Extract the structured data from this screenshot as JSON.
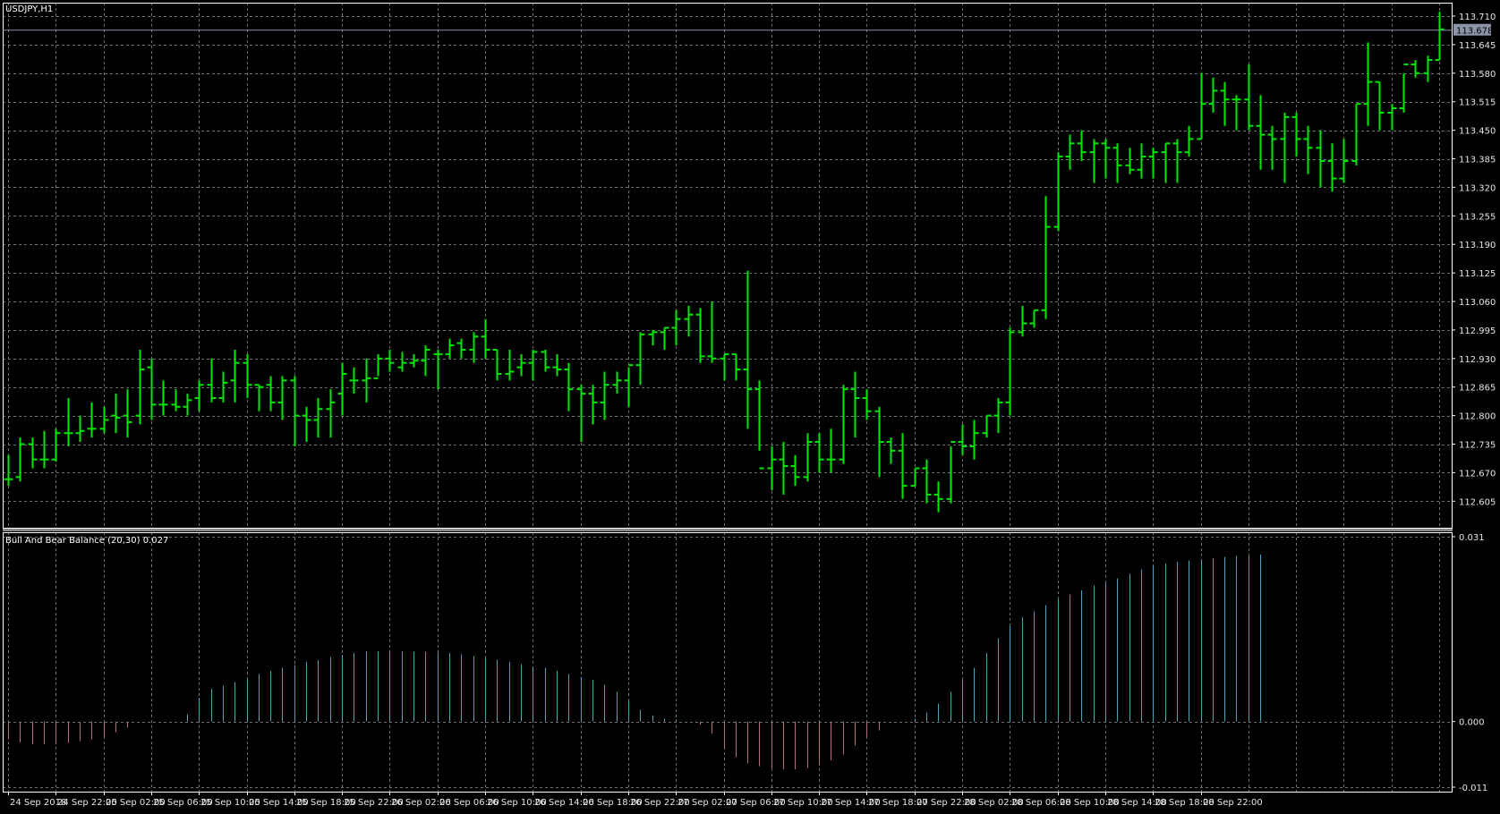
{
  "symbol_label": "USDJPY,H1",
  "indicator_label": "Bull And Bear Balance (20,30) 0.027",
  "colors": {
    "background": "#000000",
    "grid": "#6e6e6e",
    "bars": "#00e600",
    "hist_positive": "#4aa3b5",
    "hist_negative": "#b86a78",
    "current_price_tag": "#8c94a8",
    "axis_text": "#e6e6e6"
  },
  "chart_data": [
    {
      "type": "ohlc",
      "title": "USDJPY,H1",
      "ylim": [
        112.55,
        113.73
      ],
      "y_ticks": [
        "113.710",
        "113.645",
        "113.580",
        "113.515",
        "113.450",
        "113.385",
        "113.320",
        "113.255",
        "113.190",
        "113.125",
        "113.060",
        "112.995",
        "112.930",
        "112.865",
        "112.800",
        "112.735",
        "112.670",
        "112.605"
      ],
      "current_price": "113.678",
      "x_ticks": [
        "24 Sep 2018",
        "24 Sep 22:00",
        "25 Sep 02:00",
        "25 Sep 06:00",
        "25 Sep 10:00",
        "25 Sep 14:00",
        "25 Sep 18:00",
        "25 Sep 22:00",
        "26 Sep 02:00",
        "26 Sep 06:00",
        "26 Sep 10:00",
        "26 Sep 14:00",
        "26 Sep 18:00",
        "26 Sep 22:00",
        "27 Sep 02:00",
        "27 Sep 06:00",
        "27 Sep 10:00",
        "27 Sep 14:00",
        "27 Sep 18:00",
        "27 Sep 22:00",
        "28 Sep 02:00",
        "28 Sep 06:00",
        "28 Sep 10:00",
        "28 Sep 14:00",
        "28 Sep 18:00",
        "28 Sep 22:00"
      ],
      "bars": [
        [
          112.655,
          112.71,
          112.64,
          112.655
        ],
        [
          112.66,
          112.75,
          112.65,
          112.735
        ],
        [
          112.735,
          112.75,
          112.68,
          112.7
        ],
        [
          112.7,
          112.765,
          112.68,
          112.7
        ],
        [
          112.7,
          112.77,
          112.695,
          112.76
        ],
        [
          112.76,
          112.84,
          112.73,
          112.76
        ],
        [
          112.76,
          112.8,
          112.74,
          112.765
        ],
        [
          112.77,
          112.83,
          112.75,
          112.77
        ],
        [
          112.77,
          112.82,
          112.76,
          112.79
        ],
        [
          112.8,
          112.85,
          112.76,
          112.795
        ],
        [
          112.8,
          112.86,
          112.75,
          112.785
        ],
        [
          112.8,
          112.95,
          112.78,
          112.905
        ],
        [
          112.91,
          112.93,
          112.79,
          112.825
        ],
        [
          112.825,
          112.88,
          112.8,
          112.825
        ],
        [
          112.825,
          112.86,
          112.81,
          112.82
        ],
        [
          112.82,
          112.85,
          112.8,
          112.835
        ],
        [
          112.84,
          112.88,
          112.81,
          112.87
        ],
        [
          112.87,
          112.93,
          112.83,
          112.84
        ],
        [
          112.84,
          112.9,
          112.83,
          112.875
        ],
        [
          112.88,
          112.95,
          112.83,
          112.92
        ],
        [
          112.92,
          112.94,
          112.84,
          112.87
        ],
        [
          112.87,
          112.87,
          112.81,
          112.865
        ],
        [
          112.87,
          112.89,
          112.81,
          112.83
        ],
        [
          112.83,
          112.89,
          112.79,
          112.88
        ],
        [
          112.88,
          112.89,
          112.73,
          112.8
        ],
        [
          112.8,
          112.82,
          112.74,
          112.79
        ],
        [
          112.79,
          112.84,
          112.75,
          112.815
        ],
        [
          112.815,
          112.86,
          112.75,
          112.83
        ],
        [
          112.85,
          112.92,
          112.8,
          112.895
        ],
        [
          112.88,
          112.91,
          112.85,
          112.88
        ],
        [
          112.88,
          112.93,
          112.83,
          112.885
        ],
        [
          112.885,
          112.94,
          112.89,
          112.93
        ],
        [
          112.93,
          112.95,
          112.9,
          112.92
        ],
        [
          112.91,
          112.945,
          112.9,
          112.92
        ],
        [
          112.92,
          112.94,
          112.91,
          112.925
        ],
        [
          112.925,
          112.96,
          112.89,
          112.95
        ],
        [
          112.94,
          112.95,
          112.86,
          112.94
        ],
        [
          112.94,
          112.975,
          112.93,
          112.96
        ],
        [
          112.965,
          112.975,
          112.93,
          112.95
        ],
        [
          112.95,
          112.99,
          112.92,
          112.98
        ],
        [
          112.98,
          113.02,
          112.93,
          112.95
        ],
        [
          112.95,
          112.95,
          112.88,
          112.895
        ],
        [
          112.895,
          112.95,
          112.88,
          112.9
        ],
        [
          112.91,
          112.94,
          112.89,
          112.92
        ],
        [
          112.92,
          112.95,
          112.88,
          112.945
        ],
        [
          112.945,
          112.95,
          112.9,
          112.91
        ],
        [
          112.91,
          112.94,
          112.89,
          112.905
        ],
        [
          112.905,
          112.92,
          112.81,
          112.86
        ],
        [
          112.86,
          112.87,
          112.74,
          112.85
        ],
        [
          112.85,
          112.87,
          112.78,
          112.83
        ],
        [
          112.83,
          112.9,
          112.79,
          112.87
        ],
        [
          112.87,
          112.9,
          112.85,
          112.88
        ],
        [
          112.88,
          112.91,
          112.82,
          112.915
        ],
        [
          112.915,
          112.99,
          112.87,
          112.985
        ],
        [
          112.985,
          112.995,
          112.96,
          112.99
        ],
        [
          112.99,
          113.0,
          112.95,
          113.0
        ],
        [
          113.0,
          113.04,
          112.96,
          113.02
        ],
        [
          113.02,
          113.05,
          112.98,
          113.03
        ],
        [
          113.03,
          113.045,
          112.92,
          112.935
        ],
        [
          112.935,
          113.06,
          112.92,
          112.93
        ],
        [
          112.93,
          112.94,
          112.88,
          112.94
        ],
        [
          112.94,
          112.94,
          112.88,
          112.905
        ],
        [
          112.905,
          113.13,
          112.77,
          112.86
        ],
        [
          112.86,
          112.88,
          112.72,
          112.68
        ],
        [
          112.68,
          112.73,
          112.63,
          112.7
        ],
        [
          112.7,
          112.74,
          112.62,
          112.685
        ],
        [
          112.685,
          112.71,
          112.64,
          112.66
        ],
        [
          112.66,
          112.76,
          112.65,
          112.74
        ],
        [
          112.74,
          112.76,
          112.67,
          112.7
        ],
        [
          112.7,
          112.77,
          112.67,
          112.7
        ],
        [
          112.7,
          112.87,
          112.69,
          112.86
        ],
        [
          112.86,
          112.9,
          112.75,
          112.84
        ],
        [
          112.84,
          112.86,
          112.79,
          112.81
        ],
        [
          112.81,
          112.82,
          112.66,
          112.74
        ],
        [
          112.74,
          112.75,
          112.69,
          112.72
        ],
        [
          112.72,
          112.76,
          112.61,
          112.64
        ],
        [
          112.64,
          112.68,
          112.64,
          112.68
        ],
        [
          112.68,
          112.7,
          112.6,
          112.62
        ],
        [
          112.62,
          112.65,
          112.58,
          112.61
        ],
        [
          112.61,
          112.73,
          112.6,
          112.74
        ],
        [
          112.74,
          112.78,
          112.71,
          112.73
        ],
        [
          112.73,
          112.79,
          112.7,
          112.76
        ],
        [
          112.76,
          112.8,
          112.75,
          112.8
        ],
        [
          112.8,
          112.84,
          112.76,
          112.83
        ],
        [
          112.83,
          113.0,
          112.8,
          112.99
        ],
        [
          112.99,
          113.05,
          112.98,
          113.01
        ],
        [
          113.01,
          113.04,
          113.0,
          113.04
        ],
        [
          113.04,
          113.3,
          113.02,
          113.23
        ],
        [
          113.23,
          113.4,
          113.22,
          113.39
        ],
        [
          113.39,
          113.44,
          113.36,
          113.42
        ],
        [
          113.42,
          113.45,
          113.38,
          113.4
        ],
        [
          113.4,
          113.43,
          113.33,
          113.42
        ],
        [
          113.42,
          113.43,
          113.34,
          113.41
        ],
        [
          113.41,
          113.42,
          113.33,
          113.37
        ],
        [
          113.37,
          113.41,
          113.35,
          113.36
        ],
        [
          113.36,
          113.42,
          113.34,
          113.39
        ],
        [
          113.39,
          113.41,
          113.34,
          113.4
        ],
        [
          113.4,
          113.42,
          113.33,
          113.42
        ],
        [
          113.42,
          113.43,
          113.33,
          113.4
        ],
        [
          113.4,
          113.46,
          113.39,
          113.43
        ],
        [
          113.43,
          113.58,
          113.43,
          113.51
        ],
        [
          113.51,
          113.57,
          113.49,
          113.54
        ],
        [
          113.54,
          113.56,
          113.46,
          113.52
        ],
        [
          113.52,
          113.53,
          113.45,
          113.52
        ],
        [
          113.52,
          113.6,
          113.45,
          113.46
        ],
        [
          113.46,
          113.53,
          113.36,
          113.44
        ],
        [
          113.44,
          113.46,
          113.36,
          113.43
        ],
        [
          113.43,
          113.49,
          113.33,
          113.48
        ],
        [
          113.48,
          113.49,
          113.39,
          113.43
        ],
        [
          113.43,
          113.46,
          113.35,
          113.41
        ],
        [
          113.41,
          113.45,
          113.32,
          113.38
        ],
        [
          113.38,
          113.42,
          113.31,
          113.34
        ],
        [
          113.34,
          113.43,
          113.33,
          113.38
        ],
        [
          113.38,
          113.51,
          113.37,
          113.51
        ],
        [
          113.51,
          113.65,
          113.46,
          113.56
        ],
        [
          113.56,
          113.56,
          113.45,
          113.49
        ],
        [
          113.49,
          113.51,
          113.45,
          113.5
        ],
        [
          113.5,
          113.58,
          113.49,
          113.6
        ],
        [
          113.6,
          113.61,
          113.57,
          113.58
        ],
        [
          113.58,
          113.62,
          113.56,
          113.61
        ],
        [
          113.61,
          113.72,
          113.61,
          113.68
        ]
      ]
    },
    {
      "type": "histogram",
      "title": "Bull And Bear Balance (20,30) 0.027",
      "ylim": [
        -0.011,
        0.031
      ],
      "y_ticks": [
        "0.031",
        "0.000",
        "-0.011"
      ],
      "values": [
        -0.003,
        -0.0035,
        -0.0038,
        -0.0038,
        -0.0038,
        -0.0036,
        -0.0033,
        -0.003,
        -0.0025,
        -0.0018,
        -0.001,
        0,
        0,
        0,
        0,
        0.0012,
        0.004,
        0.0055,
        0.006,
        0.0066,
        0.0072,
        0.008,
        0.0085,
        0.009,
        0.0095,
        0.01,
        0.0103,
        0.0108,
        0.0112,
        0.0115,
        0.0118,
        0.0118,
        0.0118,
        0.0118,
        0.0117,
        0.0117,
        0.0116,
        0.0115,
        0.0113,
        0.011,
        0.0107,
        0.0104,
        0.01,
        0.0096,
        0.0092,
        0.009,
        0.0085,
        0.008,
        0.0075,
        0.007,
        0.0062,
        0.005,
        0.0035,
        0.002,
        0.001,
        0.0005,
        0.0003,
        0,
        -0.0005,
        -0.002,
        -0.0045,
        -0.006,
        -0.007,
        -0.0075,
        -0.0078,
        -0.008,
        -0.008,
        -0.0078,
        -0.0072,
        -0.0065,
        -0.0055,
        -0.004,
        -0.0025,
        -0.0015,
        0,
        0,
        0.0005,
        0.0015,
        0.003,
        0.005,
        0.007,
        0.009,
        0.0115,
        0.014,
        0.016,
        0.0175,
        0.0185,
        0.0195,
        0.0205,
        0.0213,
        0.022,
        0.0228,
        0.0233,
        0.024,
        0.0248,
        0.0255,
        0.0262,
        0.0265,
        0.0268,
        0.027,
        0.0272,
        0.0274,
        0.0276,
        0.0278,
        0.0278,
        0.028
      ]
    }
  ]
}
